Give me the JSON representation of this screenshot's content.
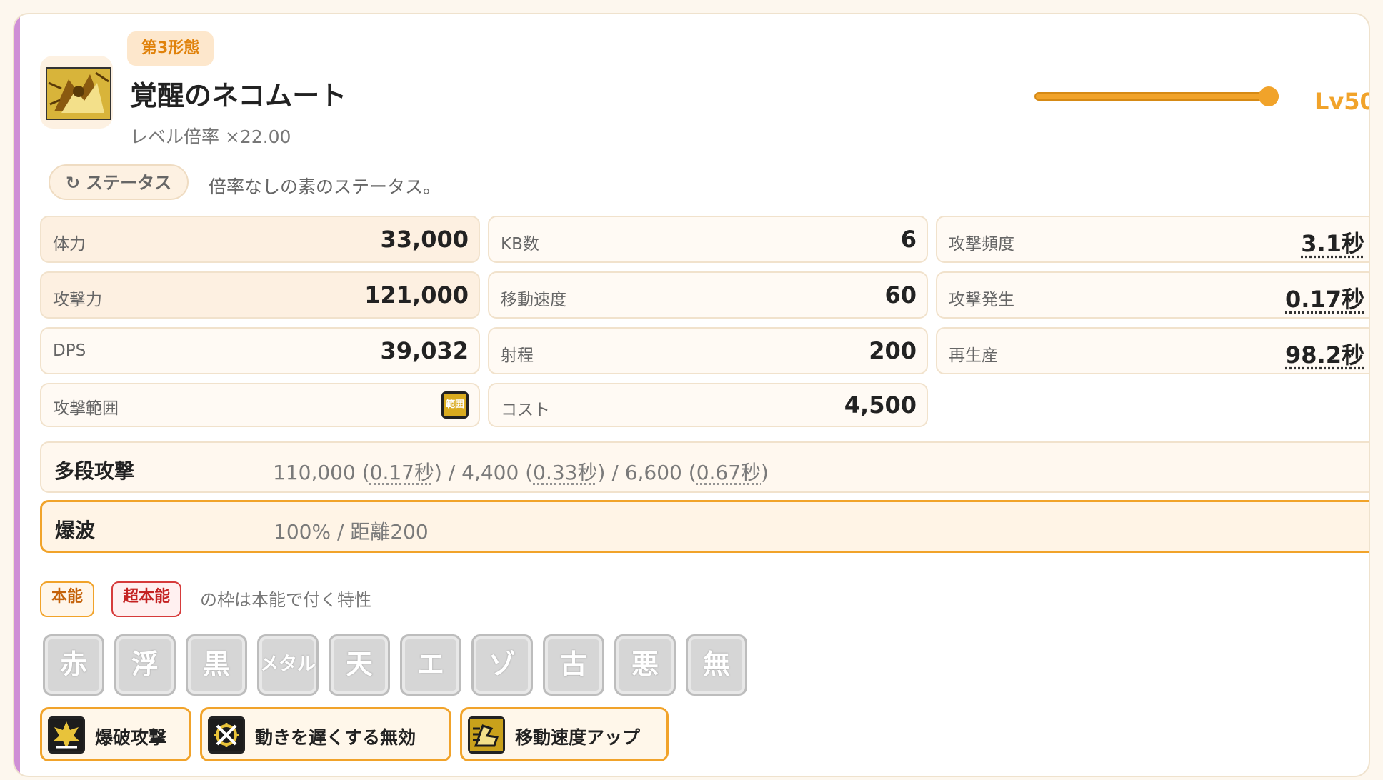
{
  "unit": {
    "form_badge": "第3形態",
    "name": "覚醒のネコムート",
    "level_ratio": "レベル倍率 ×22.00",
    "level_label": "Lv50",
    "level_value": 50,
    "level_max": 50,
    "portrait_icon": "nekomute-portrait-icon"
  },
  "status_toggle": {
    "icon": "↻",
    "label": "ステータス",
    "note": "倍率なしの素のステータス。"
  },
  "stats": {
    "hp": {
      "label": "体力",
      "value": "33,000"
    },
    "kb": {
      "label": "KB数",
      "value": "6"
    },
    "attack_rate": {
      "label": "攻撃頻度",
      "value": "3.1秒"
    },
    "attack": {
      "label": "攻撃力",
      "value": "121,000"
    },
    "speed": {
      "label": "移動速度",
      "value": "60"
    },
    "foreswing": {
      "label": "攻撃発生",
      "value": "0.17秒"
    },
    "dps": {
      "label": "DPS",
      "value": "39,032"
    },
    "range": {
      "label": "射程",
      "value": "200"
    },
    "recharge": {
      "label": "再生産",
      "value": "98.2秒"
    },
    "area": {
      "label": "攻撃範囲",
      "icon_text": "範囲"
    },
    "cost": {
      "label": "コスト",
      "value": "4,500"
    }
  },
  "multi_hit": {
    "label": "多段攻撃",
    "hits": [
      {
        "damage": "110,000",
        "time": "0.17秒"
      },
      {
        "damage": "4,400",
        "time": "0.33秒"
      },
      {
        "damage": "6,600",
        "time": "0.67秒"
      }
    ]
  },
  "wave": {
    "label": "爆波",
    "text": "100% / 距離200"
  },
  "legend": {
    "honno": "本能",
    "chohonno": "超本能",
    "note": "の枠は本能で付く特性"
  },
  "traits": [
    "赤",
    "浮",
    "黒",
    "メタル",
    "天",
    "エ",
    "ゾ",
    "古",
    "悪",
    "無"
  ],
  "abilities": [
    {
      "label": "爆破攻撃",
      "icon": "explosion-icon"
    },
    {
      "label": "動きを遅くする無効",
      "icon": "slow-immune-icon"
    },
    {
      "label": "移動速度アップ",
      "icon": "speed-up-icon"
    }
  ],
  "colors": {
    "accent": "#f1a32a",
    "form_badge_text": "#e0820b",
    "honno": "#f1a32a",
    "chohonno": "#d63b3b",
    "side_bar": "#cf8fd6"
  }
}
